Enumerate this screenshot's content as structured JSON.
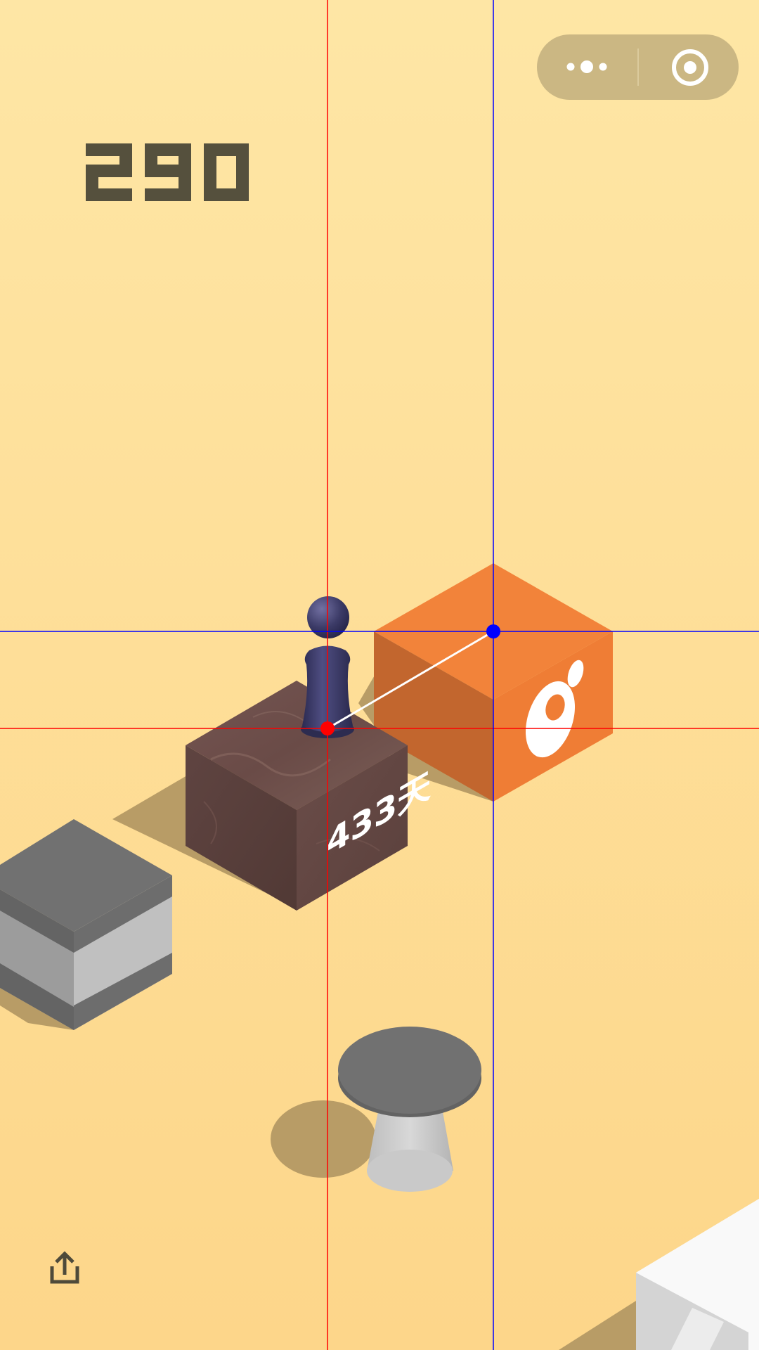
{
  "game": {
    "score": "290",
    "platform_label": "433天",
    "capsule": {
      "more_icon": "more-dots-icon",
      "close_icon": "target-circle-icon"
    },
    "share_icon": "share-upload-icon"
  },
  "colors": {
    "background_top": "#fee6a5",
    "background_bottom": "#fdd78b",
    "score_color": "#55503d",
    "orange_block": "#f08338",
    "marble_block": "#6b4a45",
    "player": "#3f3f6a",
    "guide_red": "#ff0000",
    "guide_blue": "#0000ff"
  }
}
